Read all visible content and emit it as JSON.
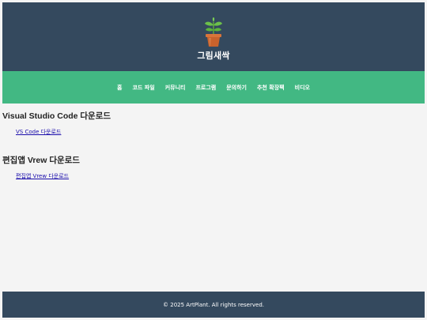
{
  "header": {
    "logo_icon": "potted-plant-icon",
    "site_title": "그림새싹"
  },
  "nav": {
    "items": [
      "홈",
      "코드 파일",
      "커뮤니티",
      "프로그램",
      "문의하기",
      "추천 확장팩",
      "비디오"
    ]
  },
  "sections": [
    {
      "title": "Visual Studio Code 다운로드",
      "link": "VS Code 다운로드"
    },
    {
      "title": "편집앱 Vrew 다운로드",
      "link": "편집앱 Vrew 다운로드"
    }
  ],
  "footer": {
    "text": "© 2025 ArtPlant. All rights reserved."
  },
  "colors": {
    "header_bg": "#34495e",
    "nav_bg": "#42b883",
    "page_bg": "#f4f4f4",
    "link": "#1a0dab"
  }
}
